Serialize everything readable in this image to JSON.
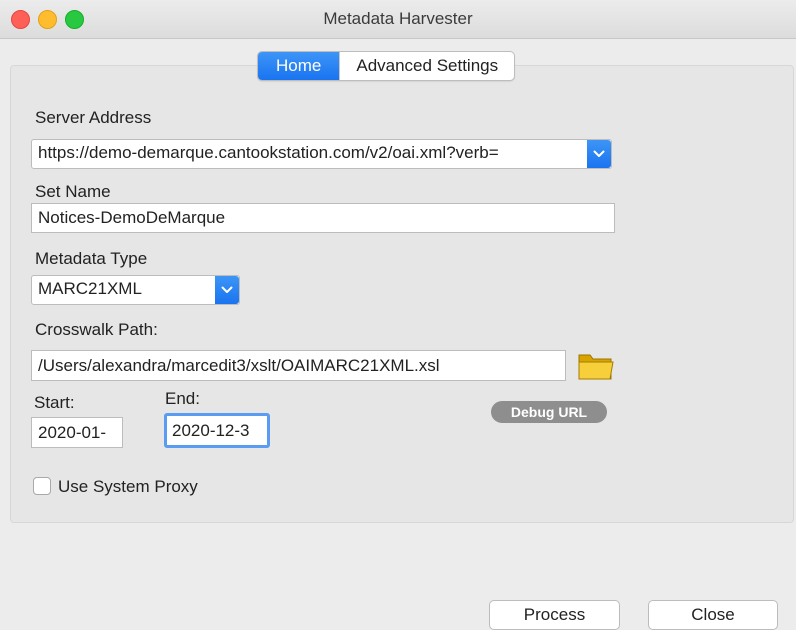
{
  "window": {
    "title": "Metadata Harvester"
  },
  "tabs": [
    {
      "label": "Home",
      "active": true
    },
    {
      "label": "Advanced Settings",
      "active": false
    }
  ],
  "form": {
    "server_address": {
      "label": "Server Address",
      "value": "https://demo-demarque.cantookstation.com/v2/oai.xml?verb="
    },
    "set_name": {
      "label": "Set Name",
      "value": "Notices-DemoDeMarque"
    },
    "metadata_type": {
      "label": "Metadata Type",
      "value": "MARC21XML"
    },
    "crosswalk_path": {
      "label": "Crosswalk Path:",
      "value": "/Users/alexandra/marcedit3/xslt/OAIMARC21XML.xsl"
    },
    "start": {
      "label": "Start:",
      "value": "2020-01-"
    },
    "end": {
      "label": "End:",
      "value": "2020-12-3"
    },
    "debug_url_label": "Debug URL",
    "use_system_proxy": {
      "label": "Use System Proxy",
      "checked": false
    }
  },
  "buttons": {
    "process": "Process",
    "close": "Close"
  },
  "icons": {
    "folder": "folder-icon",
    "dropdown": "chevron-down-icon"
  },
  "colors": {
    "accent": "#1a74f0",
    "focus_ring": "#5b9cf3",
    "debug_button": "#8e8e8e"
  }
}
